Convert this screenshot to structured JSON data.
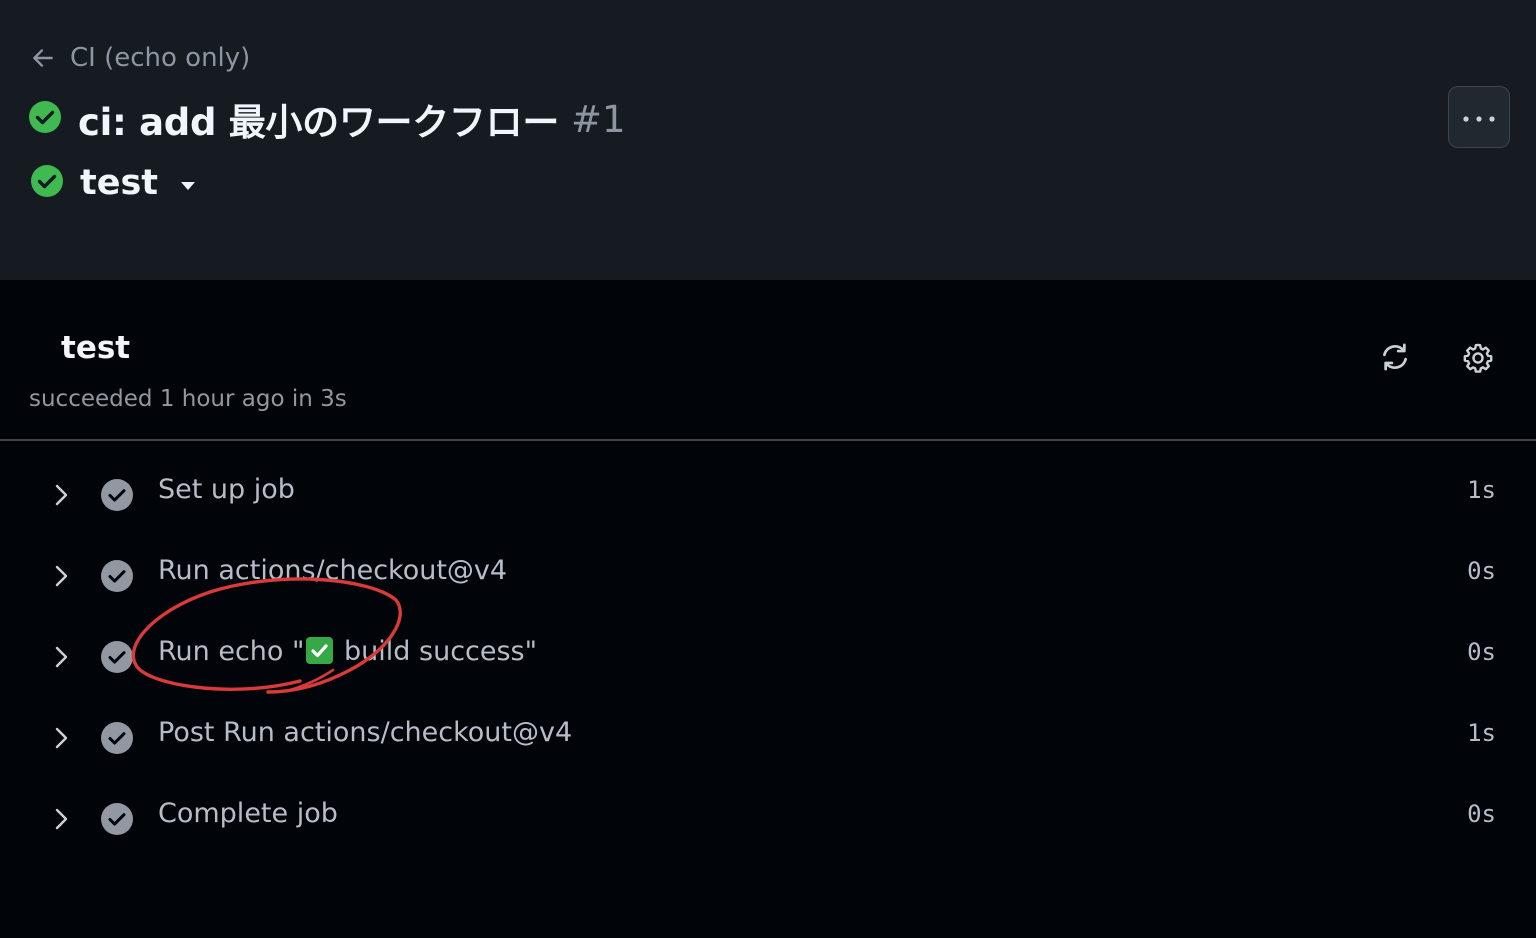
{
  "header": {
    "back_label": "CI (echo only)",
    "run_title": "ci: add 最小のワークフロー",
    "run_number": "#1",
    "job_selector_label": "test"
  },
  "job": {
    "title": "test",
    "status_text": "succeeded 1 hour ago in 3s"
  },
  "steps": [
    {
      "label": "Set up job",
      "duration": "1s"
    },
    {
      "label": "Run actions/checkout@v4",
      "duration": "0s"
    },
    {
      "label_prefix": "Run echo \"",
      "label_suffix": " build success\"",
      "duration": "0s"
    },
    {
      "label": "Post Run actions/checkout@v4",
      "duration": "1s"
    },
    {
      "label": "Complete job",
      "duration": "0s"
    }
  ],
  "icons": {
    "back": "arrow-left-icon",
    "success": "check-circle-fill-icon",
    "caret": "triangle-down-icon",
    "more": "kebab-horizontal-icon",
    "rerun": "sync-icon",
    "settings": "gear-icon",
    "expand": "chevron-right-icon",
    "step_status": "check-circle-icon"
  },
  "colors": {
    "header_bg": "#161b22",
    "page_bg": "#010409",
    "success_green": "#3fb950",
    "step_check": "#9198a1",
    "annotation_red": "#d93a3a"
  }
}
